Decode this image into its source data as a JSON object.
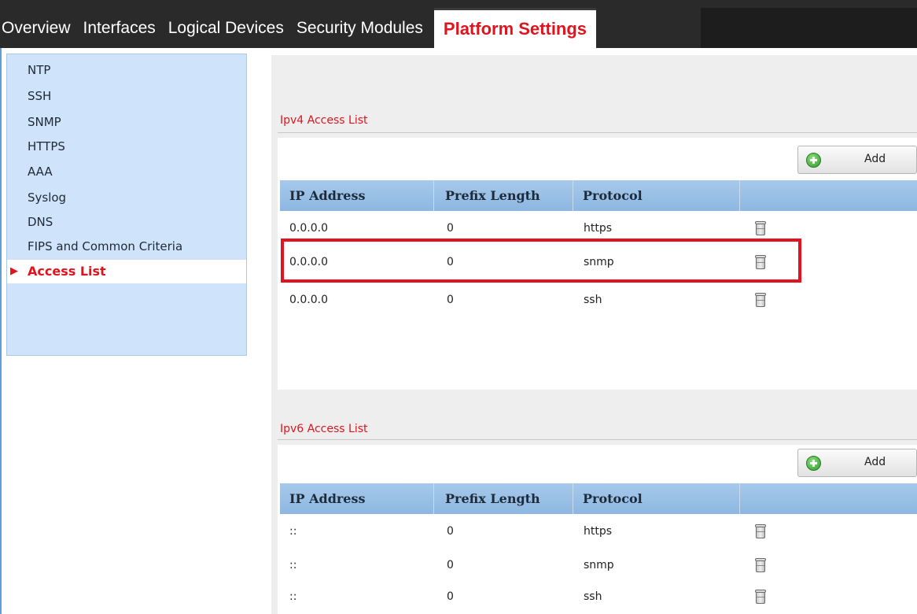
{
  "tabs": [
    {
      "label": "Overview",
      "active": false
    },
    {
      "label": "Interfaces",
      "active": false
    },
    {
      "label": "Logical Devices",
      "active": false
    },
    {
      "label": "Security Modules",
      "active": false
    },
    {
      "label": "Platform Settings",
      "active": true
    }
  ],
  "sidebar": {
    "items": [
      {
        "label": "NTP"
      },
      {
        "label": "SSH"
      },
      {
        "label": "SNMP"
      },
      {
        "label": "HTTPS"
      },
      {
        "label": "AAA"
      },
      {
        "label": "Syslog"
      },
      {
        "label": "DNS"
      },
      {
        "label": "FIPS and Common Criteria"
      },
      {
        "label": "Access List",
        "active": true
      }
    ]
  },
  "ipv4": {
    "title": "Ipv4 Access List",
    "add_label": "Add",
    "columns": [
      "IP Address",
      "Prefix Length",
      "Protocol"
    ],
    "rows": [
      {
        "ip": "0.0.0.0",
        "prefix": "0",
        "protocol": "https"
      },
      {
        "ip": "0.0.0.0",
        "prefix": "0",
        "protocol": "snmp",
        "highlighted": true
      },
      {
        "ip": "0.0.0.0",
        "prefix": "0",
        "protocol": "ssh"
      }
    ]
  },
  "ipv6": {
    "title": "Ipv6 Access List",
    "add_label": "Add",
    "columns": [
      "IP Address",
      "Prefix Length",
      "Protocol"
    ],
    "rows": [
      {
        "ip": "::",
        "prefix": "0",
        "protocol": "https"
      },
      {
        "ip": "::",
        "prefix": "0",
        "protocol": "snmp"
      },
      {
        "ip": "::",
        "prefix": "0",
        "protocol": "ssh"
      }
    ]
  },
  "colors": {
    "accent_red": "#e0141e",
    "highlight_border": "#e2121f",
    "nav_background": "#cfe4fb",
    "header_blue": "#8db7e1"
  },
  "icons": {
    "add": "plus-circle-icon",
    "delete": "trash-icon",
    "active_nav": "caret-right-icon"
  }
}
